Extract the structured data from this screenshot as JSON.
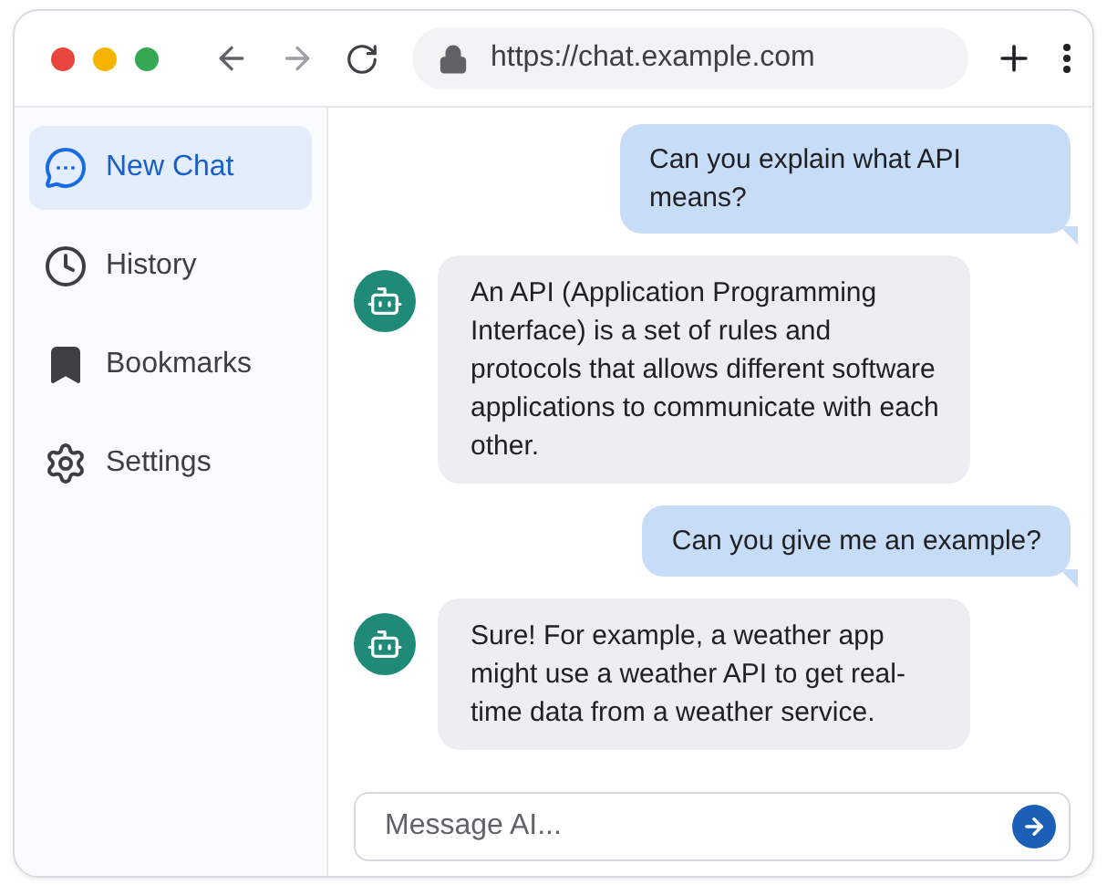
{
  "browser": {
    "url": "https://chat.example.com"
  },
  "sidebar": {
    "items": [
      {
        "label": "New Chat",
        "selected": true
      },
      {
        "label": "History",
        "selected": false
      },
      {
        "label": "Bookmarks",
        "selected": false
      },
      {
        "label": "Settings",
        "selected": false
      }
    ]
  },
  "messages": [
    {
      "kind": "user",
      "text": "Can you explain what API means?"
    },
    {
      "kind": "bot",
      "text": "An API (Application Programming Interface) is a set of rules and protocols that allows different software applications to communicate with each other."
    },
    {
      "kind": "user",
      "text": "Can you give me an example?"
    },
    {
      "kind": "bot",
      "text": "Sure! For example, a weather app might use a weather API to get real-time data from a weather service."
    }
  ],
  "composer": {
    "placeholder": "Message AI..."
  }
}
